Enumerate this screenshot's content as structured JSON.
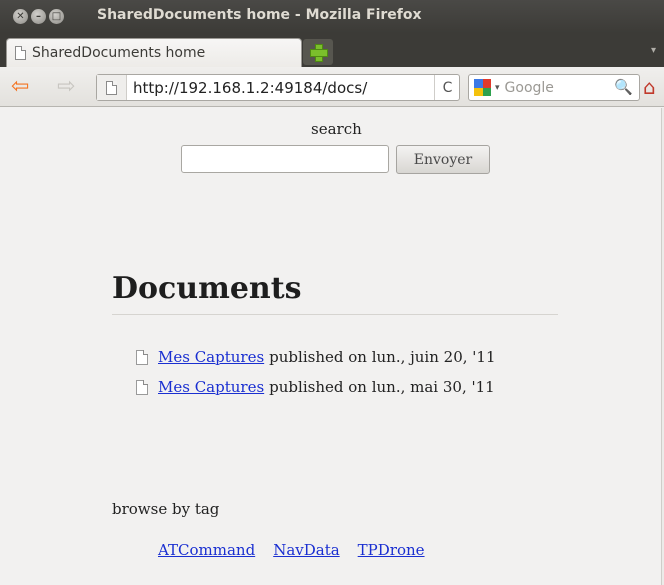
{
  "window": {
    "title": "SharedDocuments home - Mozilla Firefox",
    "close_glyph": "✕",
    "min_glyph": "–",
    "max_glyph": "□"
  },
  "tabs": [
    {
      "label": "SharedDocuments home",
      "icon": "page-icon",
      "active": true
    }
  ],
  "navbar": {
    "url": "http://192.168.1.2:49184/docs/",
    "search_placeholder": "Google",
    "back_glyph": "⇦",
    "forward_glyph": "⇨",
    "reload_glyph": "C",
    "star_glyph": "☆",
    "dropdown_glyph": "▾",
    "search_glyph": "🔍",
    "home_glyph": "⌂",
    "accent_color": "#f47421"
  },
  "page": {
    "search_label": "search",
    "search_value": "",
    "submit_label": "Envoyer",
    "heading": "Documents",
    "documents": [
      {
        "title": "Mes Captures",
        "meta": "published on lun., juin 20, '11"
      },
      {
        "title": "Mes Captures",
        "meta": "published on lun., mai 30, '11"
      }
    ],
    "browse_label": "browse by tag",
    "tags": [
      "ATCommand",
      "NavData",
      "TPDrone"
    ],
    "link_color": "#1a2fd1"
  }
}
